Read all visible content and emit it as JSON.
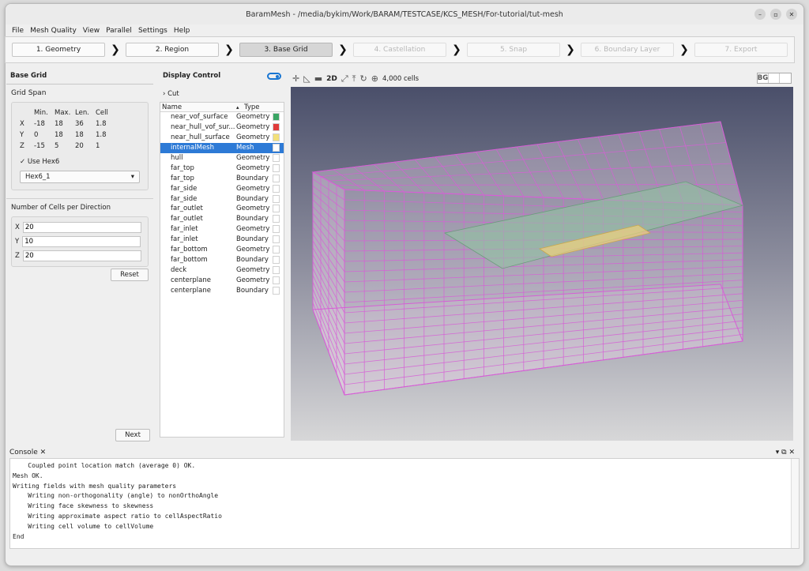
{
  "window": {
    "title": "BaramMesh - /media/bykim/Work/BARAM/TESTCASE/KCS_MESH/For-tutorial/tut-mesh"
  },
  "menu": [
    "File",
    "Mesh Quality",
    "View",
    "Parallel",
    "Settings",
    "Help"
  ],
  "steps": [
    {
      "label": "1. Geometry",
      "state": "normal"
    },
    {
      "label": "2. Region",
      "state": "normal"
    },
    {
      "label": "3. Base Grid",
      "state": "active"
    },
    {
      "label": "4. Castellation",
      "state": "disabled"
    },
    {
      "label": "5. Snap",
      "state": "disabled"
    },
    {
      "label": "6. Boundary Layer",
      "state": "disabled"
    },
    {
      "label": "7. Export",
      "state": "disabled"
    }
  ],
  "base_grid": {
    "title": "Base Grid",
    "grid_span_label": "Grid Span",
    "headers": [
      "",
      "Min.",
      "Max.",
      "Len.",
      "Cell"
    ],
    "rows": [
      [
        "X",
        "-18",
        "18",
        "36",
        "1.8"
      ],
      [
        "Y",
        "0",
        "18",
        "18",
        "1.8"
      ],
      [
        "Z",
        "-15",
        "5",
        "20",
        "1"
      ]
    ],
    "use_hex6_label": "Use Hex6",
    "use_hex6_checked": true,
    "hex6_value": "Hex6_1",
    "cells_title": "Number of Cells per Direction",
    "cells": [
      {
        "axis": "X",
        "value": "20"
      },
      {
        "axis": "Y",
        "value": "10"
      },
      {
        "axis": "Z",
        "value": "20"
      }
    ],
    "reset_label": "Reset",
    "next_label": "Next"
  },
  "display_control": {
    "title": "Display Control",
    "cut_label": "Cut",
    "col_name": "Name",
    "col_type": "Type",
    "items": [
      {
        "name": "near_vof_surface",
        "type": "Geometry",
        "color": "#3aa564"
      },
      {
        "name": "near_hull_vof_sur...",
        "type": "Geometry",
        "color": "#e03b3b"
      },
      {
        "name": "near_hull_surface",
        "type": "Geometry",
        "color": "#f2e07a"
      },
      {
        "name": "internalMesh",
        "type": "Mesh",
        "color": "#ffffff",
        "selected": true
      },
      {
        "name": "hull",
        "type": "Geometry",
        "color": "#ffffff"
      },
      {
        "name": "far_top",
        "type": "Geometry",
        "color": "#ffffff"
      },
      {
        "name": "far_top",
        "type": "Boundary",
        "color": "#ffffff"
      },
      {
        "name": "far_side",
        "type": "Geometry",
        "color": "#ffffff"
      },
      {
        "name": "far_side",
        "type": "Boundary",
        "color": "#ffffff"
      },
      {
        "name": "far_outlet",
        "type": "Geometry",
        "color": "#ffffff"
      },
      {
        "name": "far_outlet",
        "type": "Boundary",
        "color": "#ffffff"
      },
      {
        "name": "far_inlet",
        "type": "Geometry",
        "color": "#ffffff"
      },
      {
        "name": "far_inlet",
        "type": "Boundary",
        "color": "#ffffff"
      },
      {
        "name": "far_bottom",
        "type": "Geometry",
        "color": "#ffffff"
      },
      {
        "name": "far_bottom",
        "type": "Boundary",
        "color": "#ffffff"
      },
      {
        "name": "deck",
        "type": "Geometry",
        "color": "#ffffff"
      },
      {
        "name": "centerplane",
        "type": "Geometry",
        "color": "#ffffff"
      },
      {
        "name": "centerplane",
        "type": "Boundary",
        "color": "#ffffff"
      }
    ]
  },
  "view_toolbar": {
    "mode_2d": "2D",
    "cell_count": "4,000 cells",
    "bg_label": "BG"
  },
  "console": {
    "tab_label": "Console",
    "lines": [
      "    Coupled point location match (average 0) OK.",
      "Mesh OK.",
      "Writing fields with mesh quality parameters",
      "    Writing non-orthogonality (angle) to nonOrthoAngle",
      "    Writing face skewness to skewness",
      "    Writing approximate aspect ratio to cellAspectRatio",
      "    Writing cell volume to cellVolume",
      "End"
    ]
  },
  "colors": {
    "accent": "#1976d2",
    "selection": "#2d7ad6",
    "mesh_lines": "#d65fd6"
  }
}
